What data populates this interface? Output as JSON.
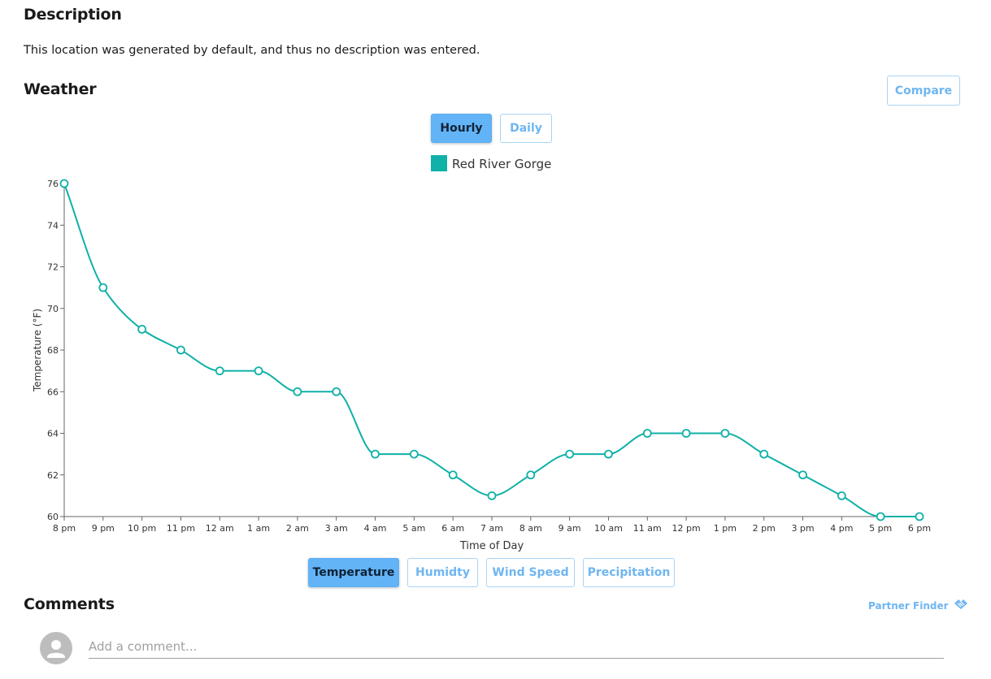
{
  "description": {
    "title": "Description",
    "text": "This location was generated by default, and thus no description was entered."
  },
  "weather": {
    "title": "Weather",
    "compare_label": "Compare",
    "period_tabs": [
      {
        "label": "Hourly",
        "active": true
      },
      {
        "label": "Daily",
        "active": false
      }
    ],
    "metric_tabs": [
      {
        "label": "Temperature",
        "active": true
      },
      {
        "label": "Humidty",
        "active": false
      },
      {
        "label": "Wind Speed",
        "active": false
      },
      {
        "label": "Precipitation",
        "active": false
      }
    ]
  },
  "chart_data": {
    "type": "line",
    "xlabel": "Time of Day",
    "ylabel": "Temperature (°F)",
    "ylim": [
      60,
      76
    ],
    "yticks": [
      60,
      62,
      64,
      66,
      68,
      70,
      72,
      74,
      76
    ],
    "categories": [
      "8 pm",
      "9 pm",
      "10 pm",
      "11 pm",
      "12 am",
      "1 am",
      "2 am",
      "3 am",
      "4 am",
      "5 am",
      "6 am",
      "7 am",
      "8 am",
      "9 am",
      "10 am",
      "11 am",
      "12 pm",
      "1 pm",
      "2 pm",
      "3 pm",
      "4 pm",
      "5 pm",
      "6 pm"
    ],
    "series": [
      {
        "name": "Red River Gorge",
        "color": "#0fb1a8",
        "values": [
          76,
          71,
          69,
          68,
          67,
          67,
          66,
          66,
          63,
          63,
          62,
          61,
          62,
          63,
          63,
          64,
          64,
          64,
          63,
          62,
          61,
          60,
          60
        ]
      }
    ],
    "legend": "top-center",
    "grid": false
  },
  "comments": {
    "title": "Comments",
    "partner_finder_label": "Partner Finder",
    "input_placeholder": "Add a comment..."
  },
  "icons": {
    "partner": "handshake-icon",
    "avatar": "person-icon"
  }
}
